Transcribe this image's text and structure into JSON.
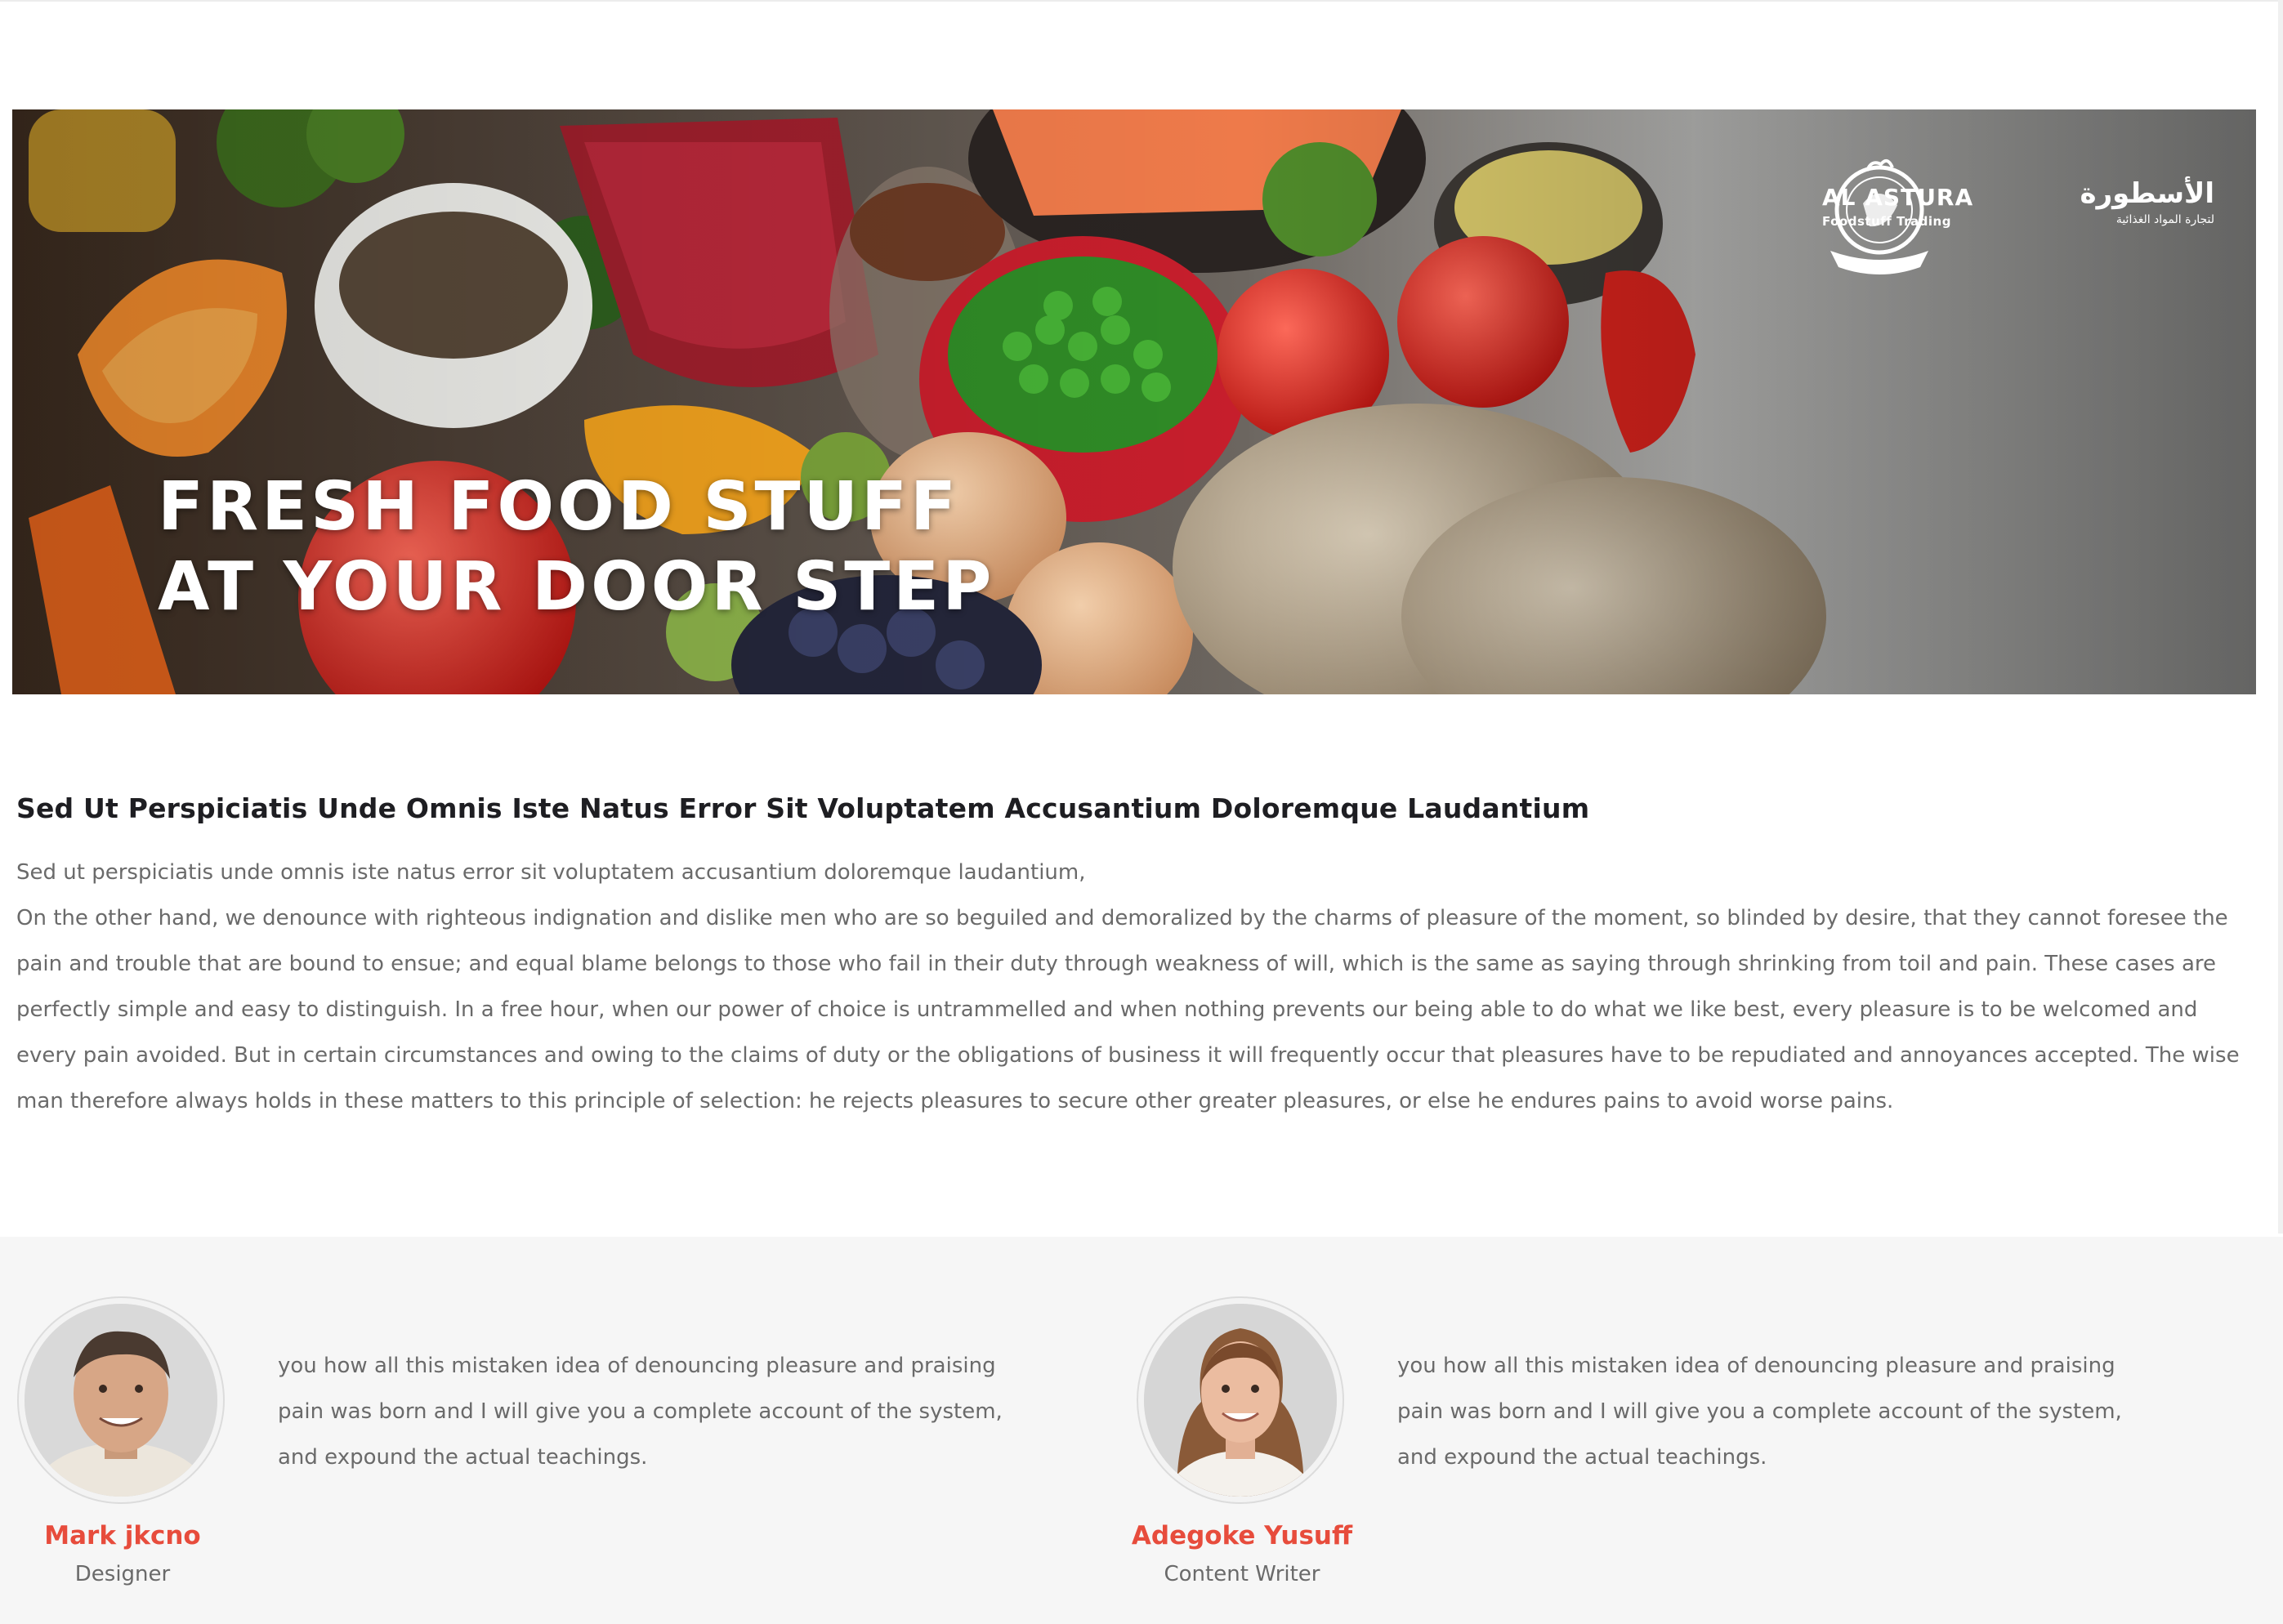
{
  "hero": {
    "title_line1": "FRESH FOOD STUFF",
    "title_line2": "AT YOUR DOOR STEP",
    "logo_en_name": "AL ASTURA",
    "logo_en_sub": "Foodstuff Trading",
    "logo_ar_name": "الأسطورة",
    "logo_ar_sub": "لتجارة المواد الغذائية"
  },
  "article": {
    "title": "Sed Ut Perspiciatis Unde Omnis Iste Natus Error Sit Voluptatem Accusantium Doloremque Laudantium",
    "lead": "Sed ut perspiciatis unde omnis iste natus error sit voluptatem accusantium doloremque laudantium,",
    "body": "On the other hand, we denounce with righteous indignation and dislike men who are so beguiled and demoralized by the charms of pleasure of the moment, so blinded by desire, that they cannot foresee the pain and trouble that are bound to ensue; and equal blame belongs to those who fail in their duty through weakness of will, which is the same as saying through shrinking from toil and pain. These cases are perfectly simple and easy to distinguish. In a free hour, when our power of choice is untrammelled and when nothing prevents our being able to do what we like best, every pleasure is to be welcomed and every pain avoided. But in certain circumstances and owing to the claims of duty or the obligations of business it will frequently occur that pleasures have to be repudiated and annoyances accepted. The wise man therefore always holds in these matters to this principle of selection: he rejects pleasures to secure other greater pleasures, or else he endures pains to avoid worse pains."
  },
  "testimonials": [
    {
      "name": "Mark jkcno",
      "role": "Designer",
      "quote": "you how all this mistaken idea of denouncing pleasure and praising pain was born and I will give you a complete account of the system, and expound the actual teachings."
    },
    {
      "name": "Adegoke Yusuff",
      "role": "Content Writer",
      "quote": "you how all this mistaken idea of denouncing pleasure and praising pain was born and I will give you a complete account of the system, and expound the actual teachings."
    }
  ],
  "colors": {
    "accent": "#e74c3c",
    "heading": "#1e1e22",
    "body_text": "#6a6a6a",
    "section_bg": "#f6f6f6"
  }
}
